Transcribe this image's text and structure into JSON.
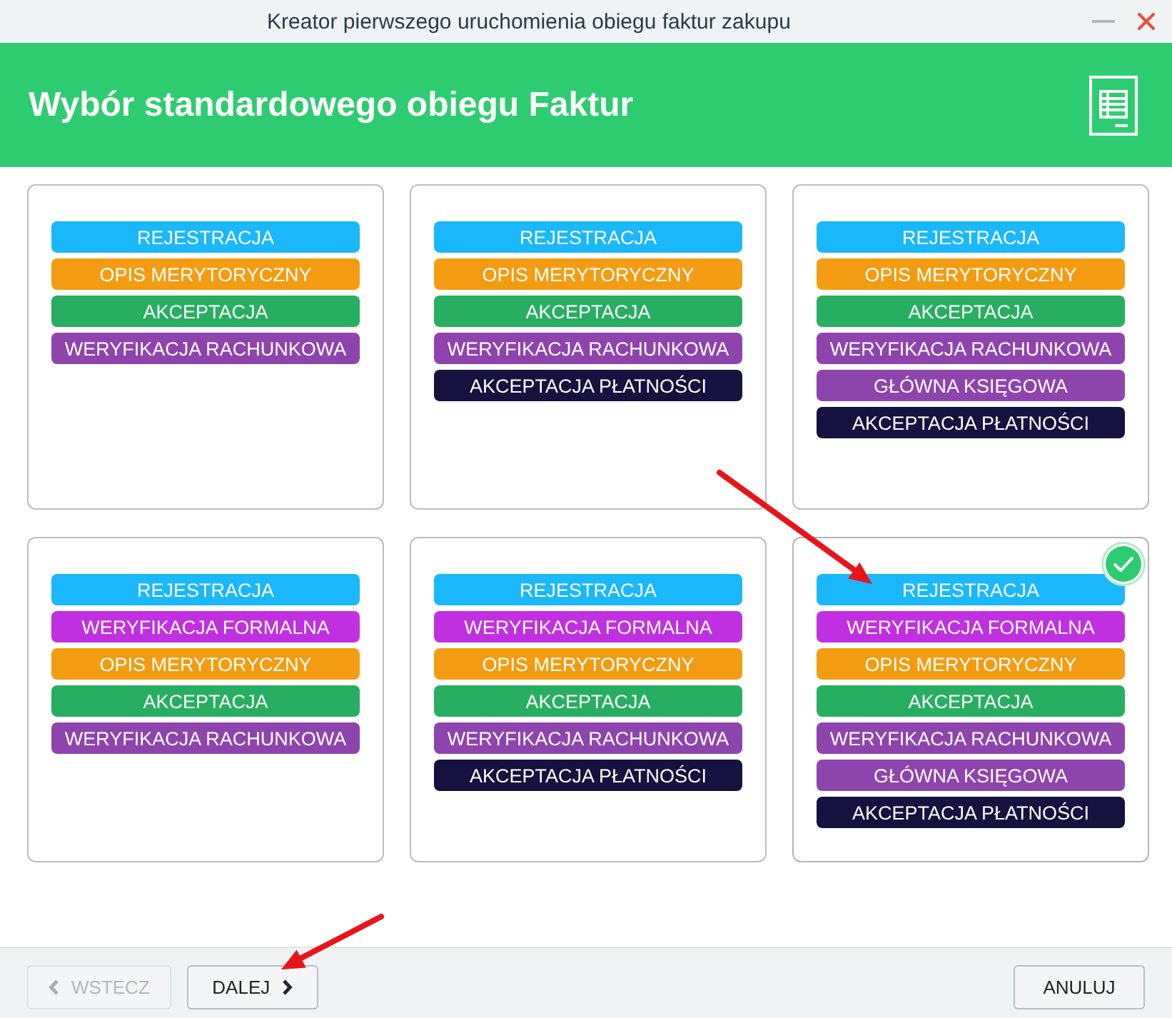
{
  "window": {
    "title": "Kreator pierwszego uruchomienia obiegu faktur zakupu"
  },
  "header": {
    "title": "Wybór standardowego obiegu Faktur"
  },
  "workflows": [
    {
      "selected": false,
      "steps": [
        {
          "label": "REJESTRACJA",
          "color": "#1ab7fb"
        },
        {
          "label": "OPIS MERYTORYCZNY",
          "color": "#f39c12"
        },
        {
          "label": "AKCEPTACJA",
          "color": "#27ae60"
        },
        {
          "label": "WERYFIKACJA RACHUNKOWA",
          "color": "#8e44ad"
        }
      ]
    },
    {
      "selected": false,
      "steps": [
        {
          "label": "REJESTRACJA",
          "color": "#1ab7fb"
        },
        {
          "label": "OPIS MERYTORYCZNY",
          "color": "#f39c12"
        },
        {
          "label": "AKCEPTACJA",
          "color": "#27ae60"
        },
        {
          "label": "WERYFIKACJA RACHUNKOWA",
          "color": "#8e44ad"
        },
        {
          "label": "AKCEPTACJA PŁATNOŚCI",
          "color": "#15123f"
        }
      ]
    },
    {
      "selected": false,
      "steps": [
        {
          "label": "REJESTRACJA",
          "color": "#1ab7fb"
        },
        {
          "label": "OPIS MERYTORYCZNY",
          "color": "#f39c12"
        },
        {
          "label": "AKCEPTACJA",
          "color": "#27ae60"
        },
        {
          "label": "WERYFIKACJA RACHUNKOWA",
          "color": "#8e44ad"
        },
        {
          "label": "GŁÓWNA KSIĘGOWA",
          "color": "#8e44ad"
        },
        {
          "label": "AKCEPTACJA PŁATNOŚCI",
          "color": "#15123f"
        }
      ]
    },
    {
      "selected": false,
      "steps": [
        {
          "label": "REJESTRACJA",
          "color": "#1ab7fb"
        },
        {
          "label": "WERYFIKACJA FORMALNA",
          "color": "#c130e0"
        },
        {
          "label": "OPIS MERYTORYCZNY",
          "color": "#f39c12"
        },
        {
          "label": "AKCEPTACJA",
          "color": "#27ae60"
        },
        {
          "label": "WERYFIKACJA RACHUNKOWA",
          "color": "#8e44ad"
        }
      ]
    },
    {
      "selected": false,
      "steps": [
        {
          "label": "REJESTRACJA",
          "color": "#1ab7fb"
        },
        {
          "label": "WERYFIKACJA FORMALNA",
          "color": "#c130e0"
        },
        {
          "label": "OPIS MERYTORYCZNY",
          "color": "#f39c12"
        },
        {
          "label": "AKCEPTACJA",
          "color": "#27ae60"
        },
        {
          "label": "WERYFIKACJA RACHUNKOWA",
          "color": "#8e44ad"
        },
        {
          "label": "AKCEPTACJA PŁATNOŚCI",
          "color": "#15123f"
        }
      ]
    },
    {
      "selected": true,
      "steps": [
        {
          "label": "REJESTRACJA",
          "color": "#1ab7fb"
        },
        {
          "label": "WERYFIKACJA FORMALNA",
          "color": "#c130e0"
        },
        {
          "label": "OPIS MERYTORYCZNY",
          "color": "#f39c12"
        },
        {
          "label": "AKCEPTACJA",
          "color": "#27ae60"
        },
        {
          "label": "WERYFIKACJA RACHUNKOWA",
          "color": "#8e44ad"
        },
        {
          "label": "GŁÓWNA KSIĘGOWA",
          "color": "#8e44ad"
        },
        {
          "label": "AKCEPTACJA PŁATNOŚCI",
          "color": "#15123f"
        }
      ]
    }
  ],
  "buttons": [
    {
      "kind": "back",
      "label": "WSTECZ",
      "disabled": true
    },
    {
      "kind": "next",
      "label": "DALEJ",
      "disabled": false
    },
    {
      "kind": "cancel",
      "label": "ANULUJ",
      "disabled": false
    }
  ]
}
